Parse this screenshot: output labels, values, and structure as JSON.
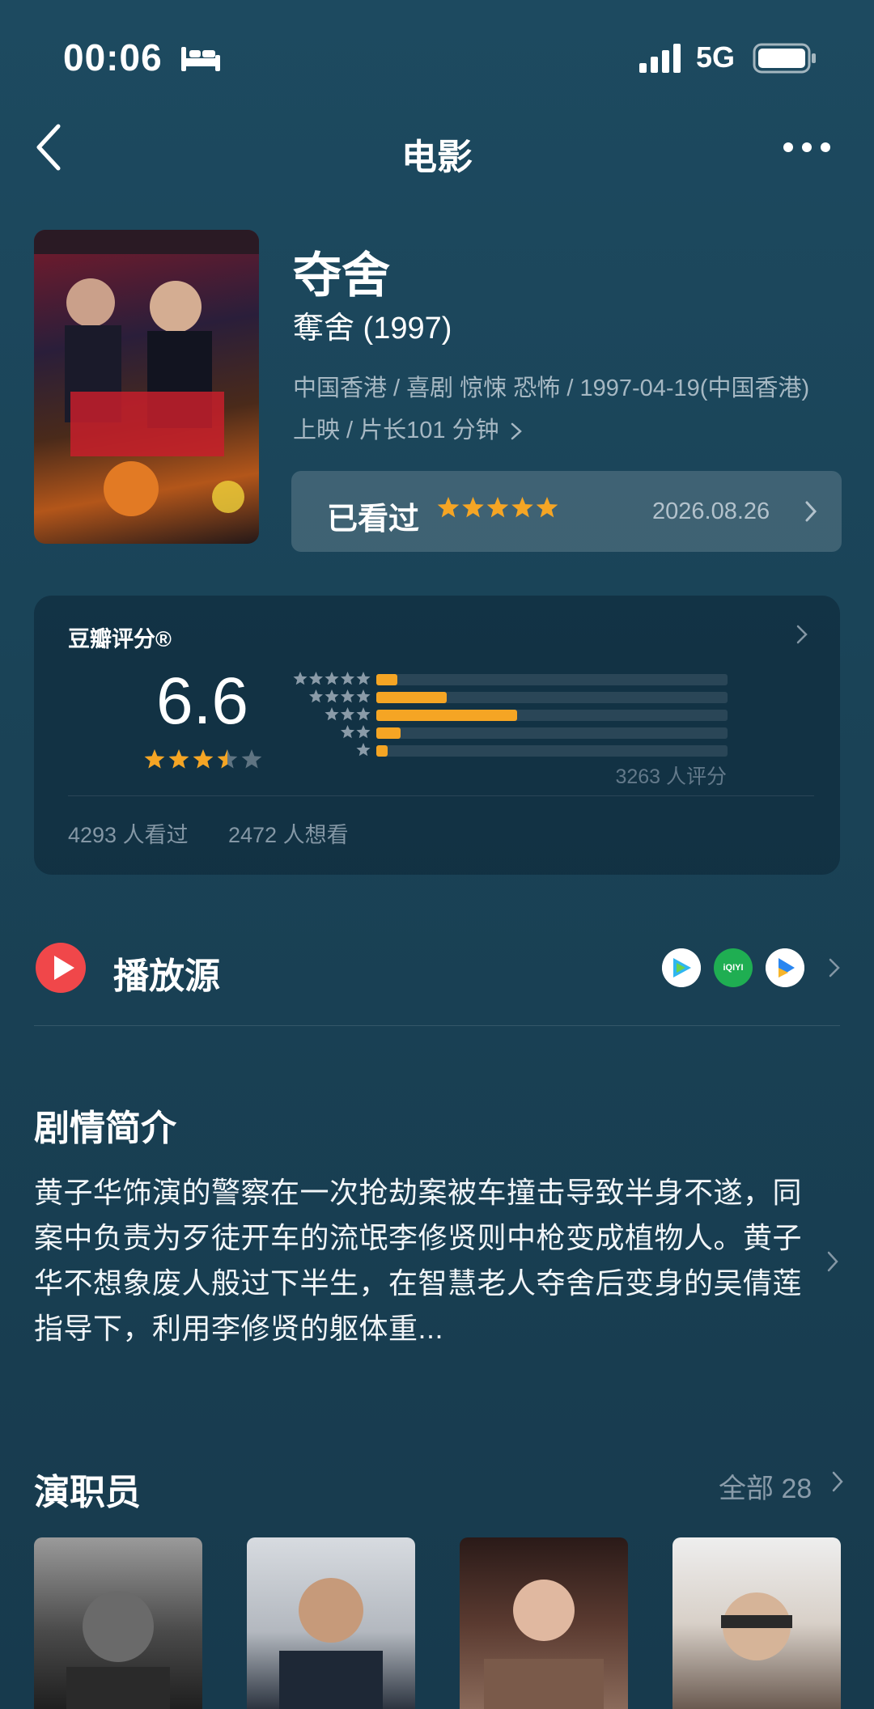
{
  "status_bar": {
    "time": "00:06",
    "network": "5G"
  },
  "nav": {
    "title": "电影"
  },
  "movie": {
    "title": "夺舍",
    "original_title": "奪舍 (1997)",
    "meta": "中国香港 / 喜剧 惊悚 恐怖 / 1997-04-19(中国香港) 上映 / 片长101 分钟"
  },
  "watched": {
    "label": "已看过",
    "stars": 5,
    "date": "2026.08.26"
  },
  "rating": {
    "title": "豆瓣评分®",
    "score": "6.6",
    "stars": 3.5,
    "distribution_fraction": [
      0.06,
      0.2,
      0.4,
      0.07,
      0.03
    ],
    "count_text": "3263 人评分",
    "watched_text": "4293 人看过",
    "want_text": "2472 人想看"
  },
  "play_source": {
    "label": "播放源",
    "sources": [
      "tencent-video-icon",
      "iqiyi-icon",
      "youku-icon"
    ],
    "iqiyi_text": "iQIYI"
  },
  "synopsis": {
    "title": "剧情简介",
    "text": "黄子华饰演的警察在一次抢劫案被车撞击导致半身不遂，同案中负责为歹徒开车的流氓李修贤则中枪变成植物人。黄子华不想象废人般过下半生，在智慧老人夺舍后变身的吴倩莲指导下，利用李修贤的躯体重..."
  },
  "cast": {
    "title": "演职员",
    "all_label": "全部 28"
  },
  "colors": {
    "accent_star": "#f5a524",
    "background": "#1a4357",
    "play_red": "#f0474a"
  }
}
